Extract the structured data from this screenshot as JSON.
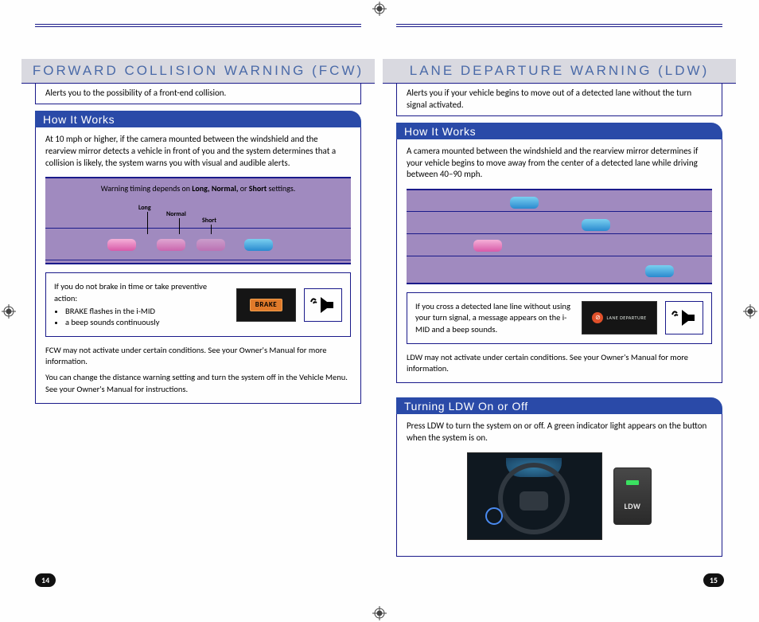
{
  "left": {
    "title": "FORWARD COLLISION WARNING (FCW)",
    "intro": "Alerts you to the possibility of a front-end collision.",
    "section1": {
      "header": "How It Works",
      "body": "At 10 mph or higher, if the camera mounted between the windshield and the rearview mirror detects a vehicle in front of you and the system determines that a collision is likely, the system warns you with visual and audible alerts.",
      "diagram_caption_pre": "Warning timing depends on ",
      "diagram_caption_bold": "Long, Normal,",
      "diagram_caption_mid": " or ",
      "diagram_caption_bold2": "Short",
      "diagram_caption_post": " settings.",
      "labels": {
        "long": "Long",
        "normal": "Normal",
        "short": "Short"
      },
      "alert_intro": "If you do not brake in time or take preventive action:",
      "alert_bullets": [
        "BRAKE flashes in the i-MID",
        "a beep sounds continuously"
      ],
      "brake_label": "BRAKE",
      "note1": "FCW may not activate under certain conditions. See your Owner's Manual for more information.",
      "note2": "You can change the distance warning setting and turn the system off in the Vehicle Menu. See your Owner's Manual for instructions."
    },
    "page_number": "14"
  },
  "right": {
    "title": "LANE DEPARTURE WARNING (LDW)",
    "intro": "Alerts you if your vehicle begins to move out of a detected lane without the turn signal activated.",
    "section1": {
      "header": "How It Works",
      "body": "A camera mounted between the windshield and the rearview mirror determines if your vehicle begins to move away from the center of a detected lane while driving between 40–90 mph.",
      "alert_text": "If you cross a detected lane line without using your turn signal, a message appears on the i-MID and a beep sounds.",
      "lane_departure_label": "LANE DEPARTURE",
      "note1": "LDW may not activate under certain conditions. See your Owner's Manual for more information."
    },
    "section2": {
      "header": "Turning LDW On or Off",
      "body": "Press LDW to turn the system on or off. A green indicator light appears on the button when the system is on.",
      "button_label": "LDW"
    },
    "page_number": "15"
  }
}
